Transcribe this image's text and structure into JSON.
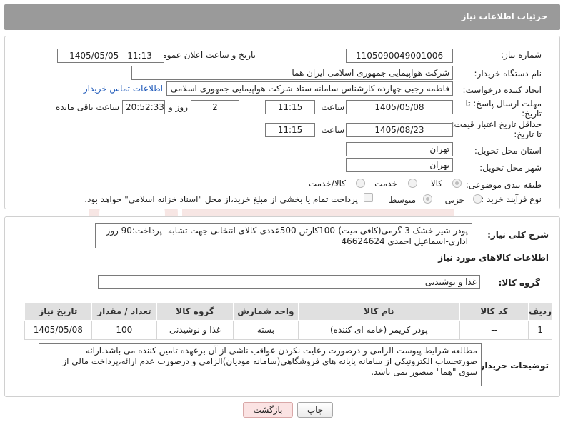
{
  "header": {
    "title": "جزئیات اطلاعات نیاز"
  },
  "form": {
    "need_number": {
      "label": "شماره نیاز:",
      "value": "1105090049001006"
    },
    "announce_datetime": {
      "label": "تاریخ و ساعت اعلان عمومی:",
      "value": "1405/05/05 - 11:13"
    },
    "buyer_org": {
      "label": "نام دستگاه خریدار:",
      "value": "شرکت هواپیمایی جمهوری اسلامی ایران هما"
    },
    "requester": {
      "label": "ایجاد کننده درخواست:",
      "value": "فاطمه رجبی چهارده کارشناس سامانه ستاد شرکت هواپیمایی جمهوری اسلامی",
      "contact_link": "اطلاعات تماس خریدار"
    },
    "reply_deadline": {
      "label_line1": "مهلت ارسال پاسخ: تا",
      "label_line2": "تاریخ:",
      "date": "1405/05/08",
      "time_label": "ساعت",
      "time": "11:15",
      "days": "2",
      "days_label": "روز و",
      "remaining": "20:52:33",
      "remaining_label": "ساعت باقی مانده"
    },
    "price_validity": {
      "label_line1": "حداقل تاریخ اعتبار قیمت:",
      "label_line2": "تا تاریخ:",
      "date": "1405/08/23",
      "time_label": "ساعت",
      "time": "11:15"
    },
    "delivery_province": {
      "label": "استان محل تحویل:",
      "value": "تهران"
    },
    "delivery_city": {
      "label": "شهر محل تحویل:",
      "value": "تهران"
    },
    "category": {
      "label": "طبقه بندی موضوعی:",
      "options": [
        "کالا",
        "خدمت",
        "کالا/خدمت"
      ],
      "selected": "کالا"
    },
    "process_type": {
      "label": "نوع فرآیند خرید :",
      "options": [
        "جزیی",
        "متوسط"
      ],
      "selected": "متوسط",
      "payment_note": "پرداخت تمام یا بخشی از مبلغ خرید،از محل \"اسناد خزانه اسلامی\" خواهد بود."
    }
  },
  "need_summary": {
    "label": "شرح کلی نیاز:",
    "text": "پودر شیر خشک 3 گرمی(کافی میت)-100کارتن 500عددی-کالای انتخابی جهت تشابه- پرداخت:90 روز اداری-اسماعیل احمدی 46624624"
  },
  "goods_info": {
    "title": "اطلاعات کالاهای مورد نیاز",
    "group_label": "گروه کالا:",
    "group_value": "غذا و نوشیدنی"
  },
  "table": {
    "columns": [
      "ردیف",
      "کد کالا",
      "نام کالا",
      "واحد شمارش",
      "گروه کالا",
      "تعداد / مقدار",
      "تاریخ نیاز"
    ],
    "rows": [
      [
        "1",
        "--",
        "پودر کریمر (خامه ای کننده)",
        "بسته",
        "غذا و نوشیدنی",
        "100",
        "1405/05/08"
      ]
    ]
  },
  "buyer_notes": {
    "label": "توضیحات خریدار:",
    "text": "مطالعه شرایط پیوست الزامی و درصورت رعایت نکردن عواقب ناشی از آن برعهده تامین کننده می باشد.ارائه صورتحساب الکترونیکی از سامانه پایانه های فروشگاهی(سامانه مودیان)الزامی و درصورت عدم ارائه،پرداخت مالی از سوی \"هما\" متصور نمی باشد."
  },
  "buttons": {
    "print": "چاپ",
    "back": "بازگشت"
  },
  "colors": {
    "header_bg": "#9a9a9a",
    "link": "#1a56b8",
    "table_header_bg": "#e0e0e0",
    "back_button_bg": "#fbe3e3"
  }
}
